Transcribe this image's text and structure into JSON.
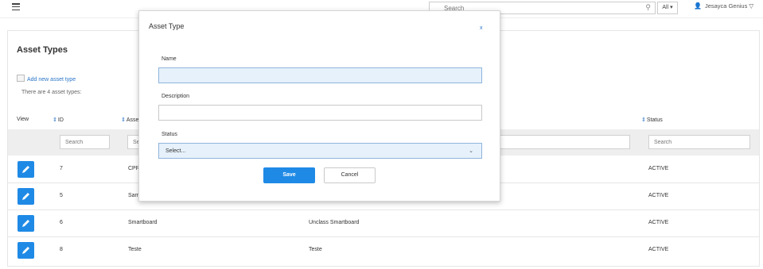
{
  "header": {
    "search_placeholder": "Search",
    "scope_label": "All ▾",
    "user_name": "Jesayca Genius ▽"
  },
  "page": {
    "title": "Asset Types",
    "add_link": "Add new asset type",
    "count_text": "There are 4 asset types:"
  },
  "table": {
    "columns": {
      "view": "View",
      "id": "ID",
      "asset_type": "Asse",
      "status": "Status"
    },
    "filter_placeholder": "Search",
    "filter_partial": "Se",
    "rows": [
      {
        "id": "7",
        "name": "CPR",
        "description": "",
        "status": "ACTIVE"
      },
      {
        "id": "5",
        "name": "Sam",
        "description": "",
        "status": "ACTIVE"
      },
      {
        "id": "6",
        "name": "Smartboard",
        "description": "Unclass Smartboard",
        "status": "ACTIVE"
      },
      {
        "id": "8",
        "name": "Teste",
        "description": "Teste",
        "status": "ACTIVE"
      }
    ]
  },
  "modal": {
    "title": "Asset Type",
    "close_label": "x",
    "name_label": "Name",
    "name_value": "",
    "description_label": "Description",
    "description_value": "",
    "status_label": "Status",
    "status_value": "Select...",
    "save_label": "Save",
    "cancel_label": "Cancel"
  },
  "colors": {
    "accent": "#1f8ae6",
    "link": "#2a74c9",
    "focused_field": "#e6f1fb"
  }
}
